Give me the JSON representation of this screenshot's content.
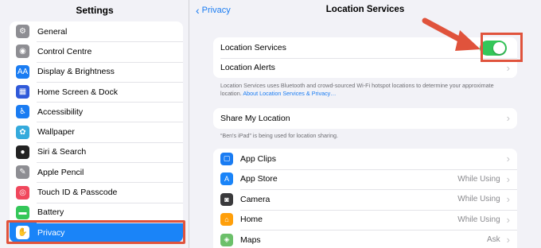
{
  "sidebar": {
    "title": "Settings",
    "items": [
      {
        "label": "General",
        "icon": "gear-icon",
        "color": "#8e8e93",
        "glyph": "⚙"
      },
      {
        "label": "Control Centre",
        "icon": "control-centre-icon",
        "color": "#8e8e93",
        "glyph": "◉"
      },
      {
        "label": "Display & Brightness",
        "icon": "display-icon",
        "color": "#1a7cf2",
        "glyph": "AA"
      },
      {
        "label": "Home Screen & Dock",
        "icon": "home-screen-icon",
        "color": "#2f59d9",
        "glyph": "▦"
      },
      {
        "label": "Accessibility",
        "icon": "accessibility-icon",
        "color": "#1a7cf2",
        "glyph": "♿"
      },
      {
        "label": "Wallpaper",
        "icon": "wallpaper-icon",
        "color": "#35aadc",
        "glyph": "✿"
      },
      {
        "label": "Siri & Search",
        "icon": "siri-icon",
        "color": "#222222",
        "glyph": "●"
      },
      {
        "label": "Apple Pencil",
        "icon": "pencil-icon",
        "color": "#8e8e93",
        "glyph": "✎"
      },
      {
        "label": "Touch ID & Passcode",
        "icon": "fingerprint-icon",
        "color": "#f0475c",
        "glyph": "◎"
      },
      {
        "label": "Battery",
        "icon": "battery-icon",
        "color": "#34c759",
        "glyph": "▬"
      },
      {
        "label": "Privacy",
        "icon": "hand-icon",
        "color": "#2f59d9",
        "glyph": "✋"
      }
    ],
    "selected": "Privacy"
  },
  "nav": {
    "back_label": "Privacy",
    "title": "Location Services"
  },
  "location": {
    "services_label": "Location Services",
    "services_on": true,
    "alerts_label": "Location Alerts",
    "footer_text": "Location Services uses Bluetooth and crowd-sourced Wi-Fi hotspot locations to determine your approximate location.",
    "footer_link": "About Location Services & Privacy…"
  },
  "share": {
    "label": "Share My Location",
    "footer": "“Ben's iPad” is being used for location sharing."
  },
  "apps": [
    {
      "label": "App Clips",
      "value": "",
      "icon": "app-clips-icon",
      "color": "#1a7cf2",
      "glyph": "▢"
    },
    {
      "label": "App Store",
      "value": "While Using",
      "icon": "app-store-icon",
      "color": "#1a84f8",
      "glyph": "A"
    },
    {
      "label": "Camera",
      "value": "While Using",
      "icon": "camera-icon",
      "color": "#3a3a3c",
      "glyph": "◙"
    },
    {
      "label": "Home",
      "value": "While Using",
      "icon": "home-icon",
      "color": "#ff9f0a",
      "glyph": "⌂"
    },
    {
      "label": "Maps",
      "value": "Ask",
      "icon": "maps-icon",
      "color": "#6cc06a",
      "glyph": "◈"
    }
  ],
  "colors": {
    "accent": "#1a7cf2",
    "toggle_on": "#34c759",
    "annotation": "#e0533c"
  }
}
